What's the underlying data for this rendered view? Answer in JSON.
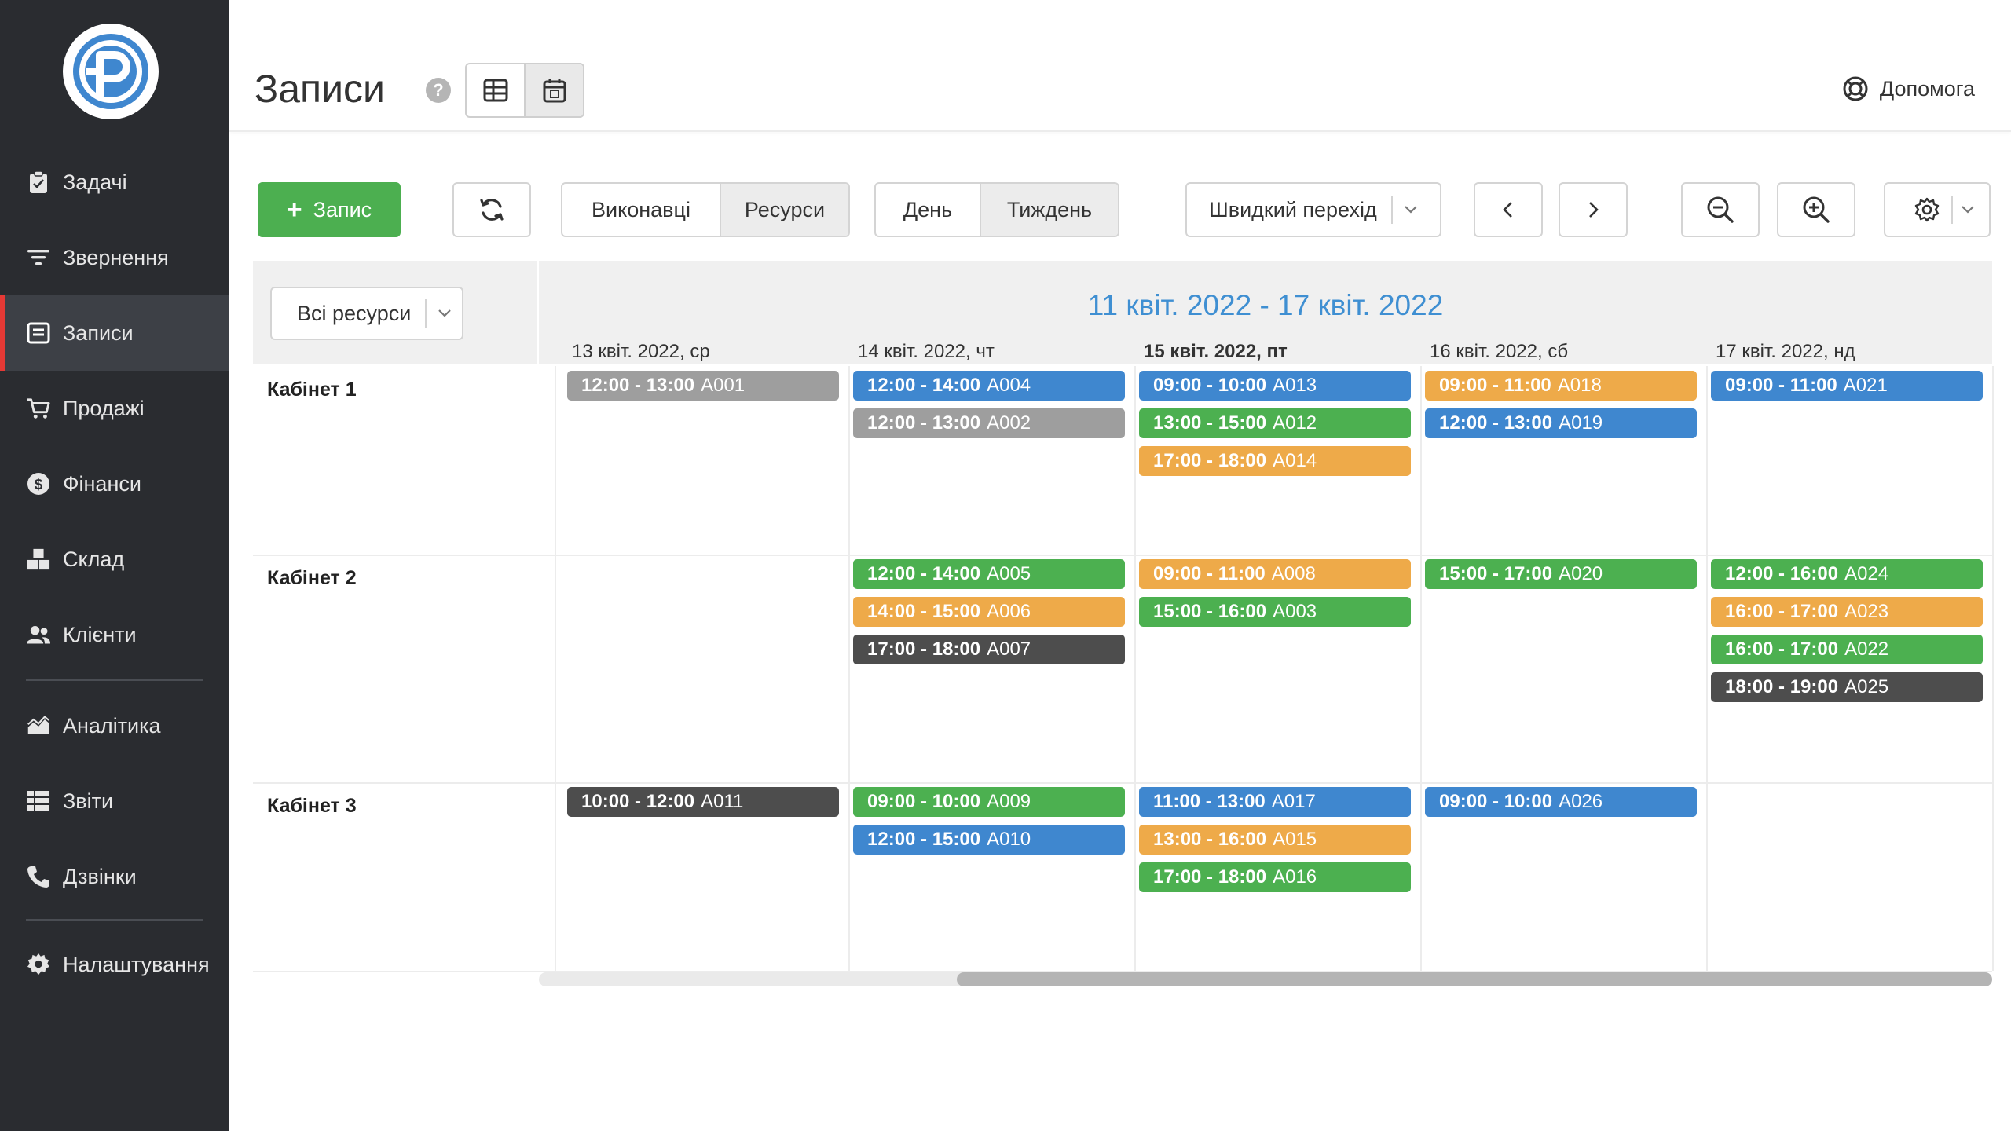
{
  "sidebar": {
    "items": [
      {
        "label": "Задачі",
        "icon": "clipboard-icon"
      },
      {
        "label": "Звернення",
        "icon": "filter-lines-icon"
      },
      {
        "label": "Записи",
        "icon": "calendar-note-icon",
        "active": true
      },
      {
        "label": "Продажі",
        "icon": "cart-icon"
      },
      {
        "label": "Фінанси",
        "icon": "dollar-circle-icon"
      },
      {
        "label": "Склад",
        "icon": "boxes-icon"
      },
      {
        "label": "Клієнти",
        "icon": "users-icon"
      },
      {
        "label": "Аналітика",
        "icon": "area-chart-icon"
      },
      {
        "label": "Звіти",
        "icon": "table-list-icon"
      },
      {
        "label": "Дзвінки",
        "icon": "phone-icon"
      },
      {
        "label": "Налаштування",
        "icon": "gear-icon"
      }
    ],
    "accent": "#e53935"
  },
  "header": {
    "title": "Записи",
    "help_badge": "?",
    "help_link": "Допомога"
  },
  "toolbar": {
    "add_label": "Запис",
    "performers_label": "Виконавці",
    "resources_label": "Ресурси",
    "day_label": "День",
    "week_label": "Тиждень",
    "quick_jump_label": "Швидкий перехід",
    "active_view": "Тиждень"
  },
  "calendar": {
    "resource_filter": "Всі ресурси",
    "range_title": "11 квіт. 2022 - 17 квіт. 2022",
    "days": [
      {
        "label": "13 квіт. 2022, ср",
        "today": false
      },
      {
        "label": "14 квіт. 2022, чт",
        "today": false
      },
      {
        "label": "15 квіт. 2022, пт",
        "today": true
      },
      {
        "label": "16 квіт. 2022, сб",
        "today": false
      },
      {
        "label": "17 квіт. 2022, нд",
        "today": false
      }
    ],
    "resources": [
      {
        "name": "Кабінет 1",
        "events": [
          [
            {
              "time": "12:00 - 13:00",
              "id": "A001",
              "color": "gray"
            }
          ],
          [
            {
              "time": "12:00 - 14:00",
              "id": "A004",
              "color": "blue"
            },
            {
              "time": "12:00 - 13:00",
              "id": "A002",
              "color": "gray"
            }
          ],
          [
            {
              "time": "09:00 - 10:00",
              "id": "A013",
              "color": "blue"
            },
            {
              "time": "13:00 - 15:00",
              "id": "A012",
              "color": "green"
            },
            {
              "time": "17:00 - 18:00",
              "id": "A014",
              "color": "orange"
            }
          ],
          [
            {
              "time": "09:00 - 11:00",
              "id": "A018",
              "color": "orange"
            },
            {
              "time": "12:00 - 13:00",
              "id": "A019",
              "color": "blue"
            }
          ],
          [
            {
              "time": "09:00 - 11:00",
              "id": "A021",
              "color": "blue"
            }
          ]
        ]
      },
      {
        "name": "Кабінет 2",
        "events": [
          [],
          [
            {
              "time": "12:00 - 14:00",
              "id": "A005",
              "color": "green"
            },
            {
              "time": "14:00 - 15:00",
              "id": "A006",
              "color": "orange"
            },
            {
              "time": "17:00 - 18:00",
              "id": "A007",
              "color": "dark"
            }
          ],
          [
            {
              "time": "09:00 - 11:00",
              "id": "A008",
              "color": "orange"
            },
            {
              "time": "15:00 - 16:00",
              "id": "A003",
              "color": "green"
            }
          ],
          [
            {
              "time": "15:00 - 17:00",
              "id": "A020",
              "color": "green"
            }
          ],
          [
            {
              "time": "12:00 - 16:00",
              "id": "A024",
              "color": "green"
            },
            {
              "time": "16:00 - 17:00",
              "id": "A023",
              "color": "orange"
            },
            {
              "time": "16:00 - 17:00",
              "id": "A022",
              "color": "green"
            },
            {
              "time": "18:00 - 19:00",
              "id": "A025",
              "color": "dark"
            }
          ]
        ]
      },
      {
        "name": "Кабінет 3",
        "events": [
          [
            {
              "time": "10:00 - 12:00",
              "id": "A011",
              "color": "dark"
            }
          ],
          [
            {
              "time": "09:00 - 10:00",
              "id": "A009",
              "color": "green"
            },
            {
              "time": "12:00 - 15:00",
              "id": "A010",
              "color": "blue"
            }
          ],
          [
            {
              "time": "11:00 - 13:00",
              "id": "A017",
              "color": "blue"
            },
            {
              "time": "13:00 - 16:00",
              "id": "A015",
              "color": "orange"
            },
            {
              "time": "17:00 - 18:00",
              "id": "A016",
              "color": "green"
            }
          ],
          [
            {
              "time": "09:00 - 10:00",
              "id": "A026",
              "color": "blue"
            }
          ],
          []
        ]
      }
    ]
  },
  "colors": {
    "blue": "#3f87cf",
    "green": "#4cb050",
    "orange": "#eeaa49",
    "gray": "#9e9e9e",
    "dark": "#4d4d4d",
    "range_title": "#3f8fd2",
    "add_button": "#4caf50"
  }
}
